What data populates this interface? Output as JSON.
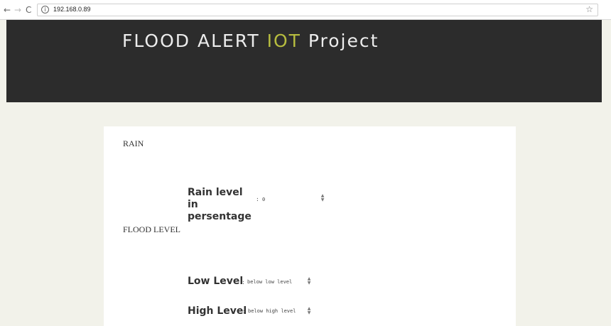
{
  "browser": {
    "back_icon": "←",
    "forward_icon": "→",
    "reload_icon": "C",
    "info_icon": "i",
    "url": "192.168.0.89",
    "bookmark_icon": "☆"
  },
  "header": {
    "title_part1": "FLOOD ALERT ",
    "title_accent": "IOT",
    "title_part2": " Project",
    "accent_color": "#b6bc3f",
    "background_color": "#2c2c2c"
  },
  "rain": {
    "section_title": "RAIN",
    "label": "Rain level in persentage",
    "colon": ":",
    "value": "0"
  },
  "flood": {
    "section_title": "FLOOD LEVEL",
    "low_label": "Low Level",
    "low_colon": ":",
    "low_value": "below low level",
    "high_label": "High Level",
    "high_colon": ":",
    "high_value": "below high level"
  }
}
